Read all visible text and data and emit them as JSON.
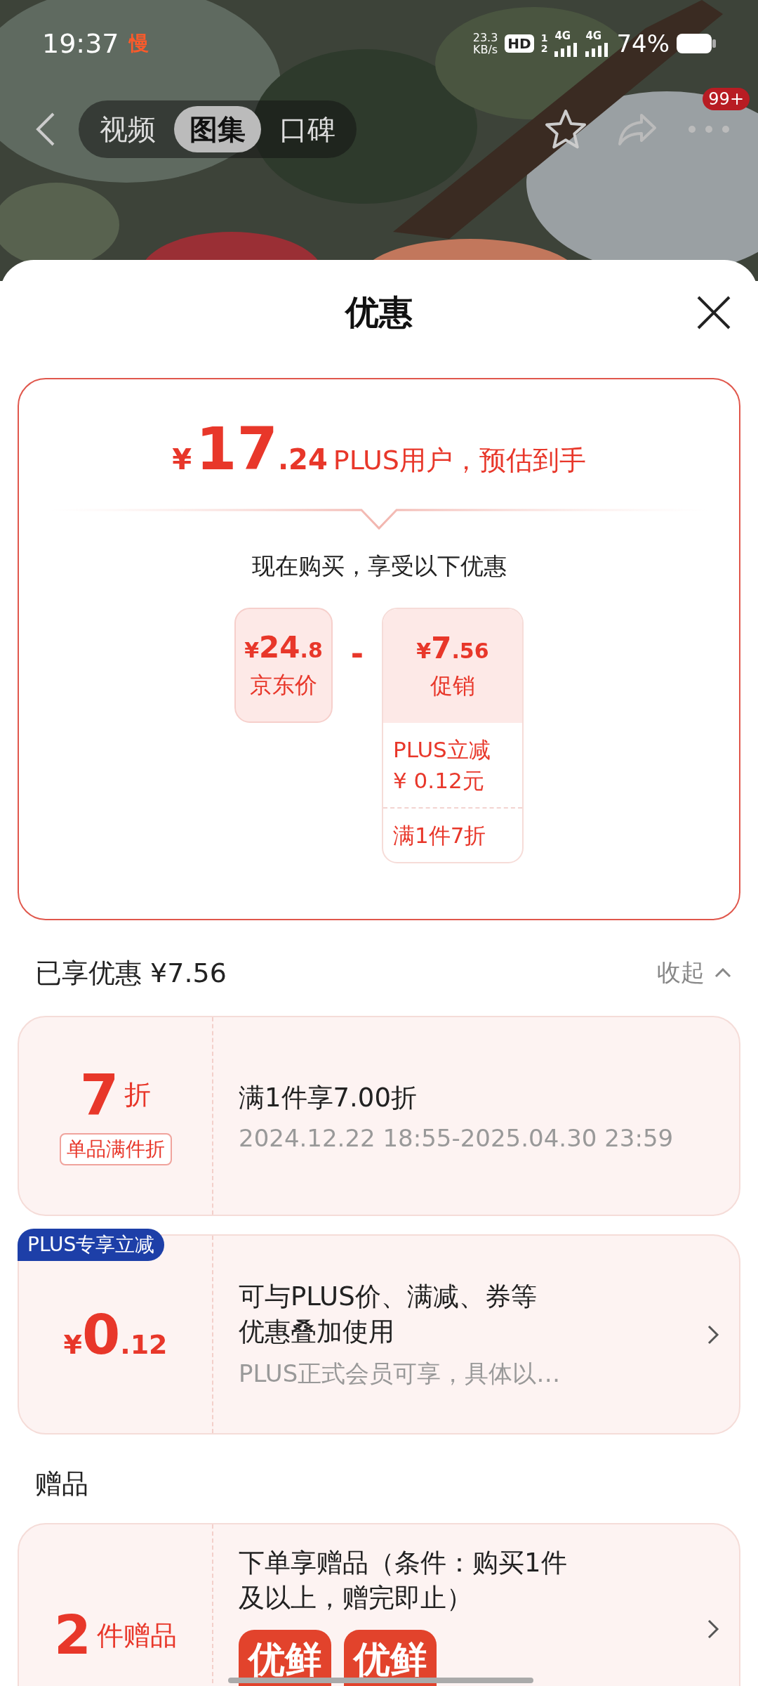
{
  "status_bar": {
    "time": "19:37",
    "slow_label": "慢",
    "net_speed": "23.3",
    "net_unit": "KB/s",
    "hd_badge": "HD",
    "sim_numbers": [
      "1",
      "2"
    ],
    "network_1": "4G",
    "network_2": "4G",
    "battery": "74%"
  },
  "nav": {
    "tabs": [
      {
        "label": "视频",
        "selected": false
      },
      {
        "label": "图集",
        "selected": true
      },
      {
        "label": "口碑",
        "selected": false
      }
    ],
    "more_badge": "99+"
  },
  "sheet": {
    "title": "优惠",
    "estimate": {
      "currency": "¥",
      "integer": "17",
      "decimal": ".24",
      "note": "PLUS用户，预估到手"
    },
    "subtitle": "现在购买，享受以下优惠",
    "list_price": {
      "currency": "¥",
      "integer": "24",
      "decimal": ".8",
      "label": "京东价"
    },
    "minus": "-",
    "promo": {
      "currency": "¥",
      "integer": "7",
      "decimal": ".56",
      "label": "促销",
      "items": [
        {
          "lines": [
            "PLUS立减",
            "¥ 0.12元"
          ]
        },
        {
          "lines": [
            "满1件7折"
          ]
        }
      ]
    },
    "enjoyed": {
      "label": "已享优惠 ¥7.56",
      "toggle": "收起"
    },
    "coupons": [
      {
        "kind": "discount",
        "value": "7",
        "unit": "折",
        "tag": "单品满件折",
        "title_lines": [
          "满1件享7.00折"
        ],
        "detail": "2024.12.22 18:55-2025.04.30 23:59",
        "has_chevron": false
      },
      {
        "kind": "amount",
        "badge": "PLUS专享立减",
        "currency": "¥",
        "integer": "0",
        "decimal": ".12",
        "title_lines": [
          "可与PLUS价、满减、券等",
          "优惠叠加使用"
        ],
        "detail": "PLUS正式会员可享，具体以…",
        "has_chevron": true
      }
    ],
    "gifts_heading": "赠品",
    "gift": {
      "count": "2",
      "unit": "件赠品",
      "title_lines": [
        "下单享赠品（条件：购买1件",
        "及以上，赠完即止）"
      ],
      "items": [
        "优鲜",
        "优鲜"
      ],
      "has_chevron": true
    }
  }
}
